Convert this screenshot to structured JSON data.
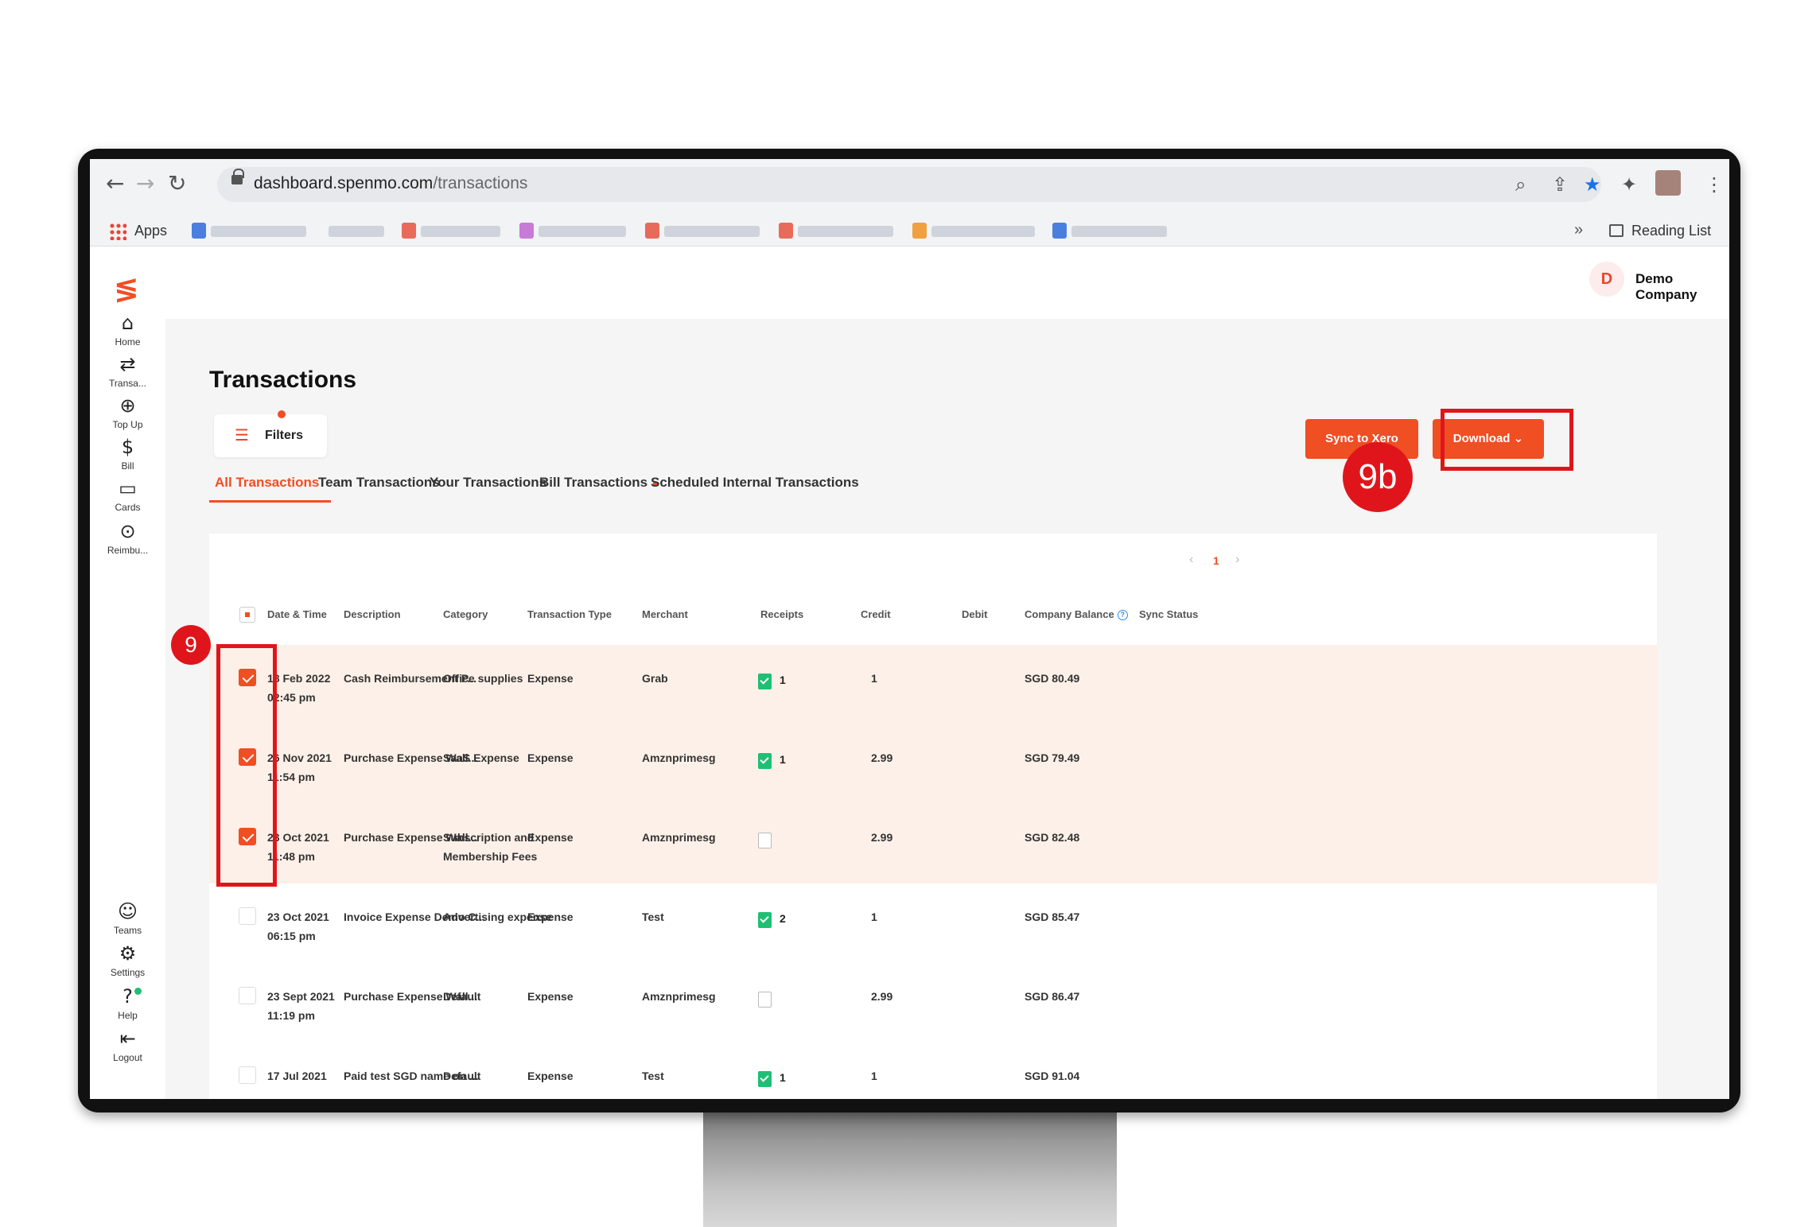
{
  "browser": {
    "url_domain": "dashboard.spenmo.com",
    "url_path": "/transactions",
    "apps_label": "Apps",
    "overflow_label": "»",
    "reading_list_label": "Reading List"
  },
  "sidebar": {
    "items": [
      {
        "label": "Home",
        "icon": "home-icon",
        "glyph": "⌂"
      },
      {
        "label": "Transa...",
        "icon": "transfer-icon",
        "glyph": "⇄"
      },
      {
        "label": "Top Up",
        "icon": "top-up-icon",
        "glyph": "⊕"
      },
      {
        "label": "Bill",
        "icon": "bill-icon",
        "glyph": "$"
      },
      {
        "label": "Cards",
        "icon": "card-icon",
        "glyph": "▭"
      },
      {
        "label": "Reimbu...",
        "icon": "reimbursement-icon",
        "glyph": "⊙"
      }
    ],
    "bottom_items": [
      {
        "label": "Teams",
        "icon": "teams-icon",
        "glyph": "☺"
      },
      {
        "label": "Settings",
        "icon": "gear-icon",
        "glyph": "⚙"
      },
      {
        "label": "Help",
        "icon": "help-icon",
        "glyph": "?"
      },
      {
        "label": "Logout",
        "icon": "logout-icon",
        "glyph": "⇤"
      }
    ]
  },
  "header": {
    "company_initial": "D",
    "company_name": "Demo Company"
  },
  "page": {
    "title": "Transactions",
    "filters_label": "Filters",
    "sync_label": "Sync to Xero",
    "download_label": "Download ⌄",
    "tabs": [
      {
        "label": "All Transactions",
        "active": true
      },
      {
        "label": "Team Transactions",
        "active": false
      },
      {
        "label": "Your Transactions",
        "active": false
      },
      {
        "label": "Bill Transactions",
        "active": false,
        "dot": true
      },
      {
        "label": "Scheduled Internal Transactions",
        "active": false
      }
    ],
    "pagination": {
      "prev": "‹",
      "current": "1",
      "next": "›"
    }
  },
  "table": {
    "columns": [
      "Date & Time",
      "Description",
      "Category",
      "Transaction Type",
      "Merchant",
      "Receipts",
      "Credit",
      "Debit",
      "Company Balance",
      "Sync Status"
    ],
    "rows": [
      {
        "selected": true,
        "date": "18 Feb 2022",
        "time": "02:45 pm",
        "description": "Cash Reimbursement P...",
        "category": "Office supplies",
        "category2": "",
        "type": "Expense",
        "merchant": "Grab",
        "receipts": "1",
        "credit": "1",
        "debit": "",
        "balance": "SGD 80.49",
        "sync": ""
      },
      {
        "selected": true,
        "date": "26 Nov 2021",
        "time": "11:54 pm",
        "description": "Purchase Expense Wall...",
        "category": "SaaS Expense",
        "category2": "",
        "type": "Expense",
        "merchant": "Amznprimesg",
        "receipts": "1",
        "credit": "2.99",
        "debit": "",
        "balance": "SGD 79.49",
        "sync": ""
      },
      {
        "selected": true,
        "date": "23 Oct 2021",
        "time": "11:48 pm",
        "description": "Purchase Expense Wall...",
        "category": "Subscription and",
        "category2": "Membership Fees",
        "type": "Expense",
        "merchant": "Amznprimesg",
        "receipts": "",
        "credit": "2.99",
        "debit": "",
        "balance": "SGD 82.48",
        "sync": ""
      },
      {
        "selected": false,
        "date": "23 Oct 2021",
        "time": "06:15 pm",
        "description": "Invoice Expense Demo C...",
        "category": "Advertising expense",
        "category2": "",
        "type": "Expense",
        "merchant": "Test",
        "receipts": "2",
        "credit": "1",
        "debit": "",
        "balance": "SGD 85.47",
        "sync": ""
      },
      {
        "selected": false,
        "date": "23 Sept 2021",
        "time": "11:19 pm",
        "description": "Purchase Expense Wall...",
        "category": "Default",
        "category2": "",
        "type": "Expense",
        "merchant": "Amznprimesg",
        "receipts": "",
        "credit": "2.99",
        "debit": "",
        "balance": "SGD 86.47",
        "sync": ""
      },
      {
        "selected": false,
        "date": "17 Jul 2021",
        "time": "",
        "description": "Paid test SGD name on ...",
        "category": "Default",
        "category2": "",
        "type": "Expense",
        "merchant": "Test",
        "receipts": "1",
        "credit": "1",
        "debit": "",
        "balance": "SGD 91.04",
        "sync": ""
      }
    ]
  },
  "annotations": {
    "rows_badge": "9",
    "sync_badge": "9b",
    "color": "#e0151b"
  },
  "colors": {
    "accent": "#f04e23",
    "receipt_green": "#1fbf74",
    "selected_row": "#fdf0e8"
  }
}
